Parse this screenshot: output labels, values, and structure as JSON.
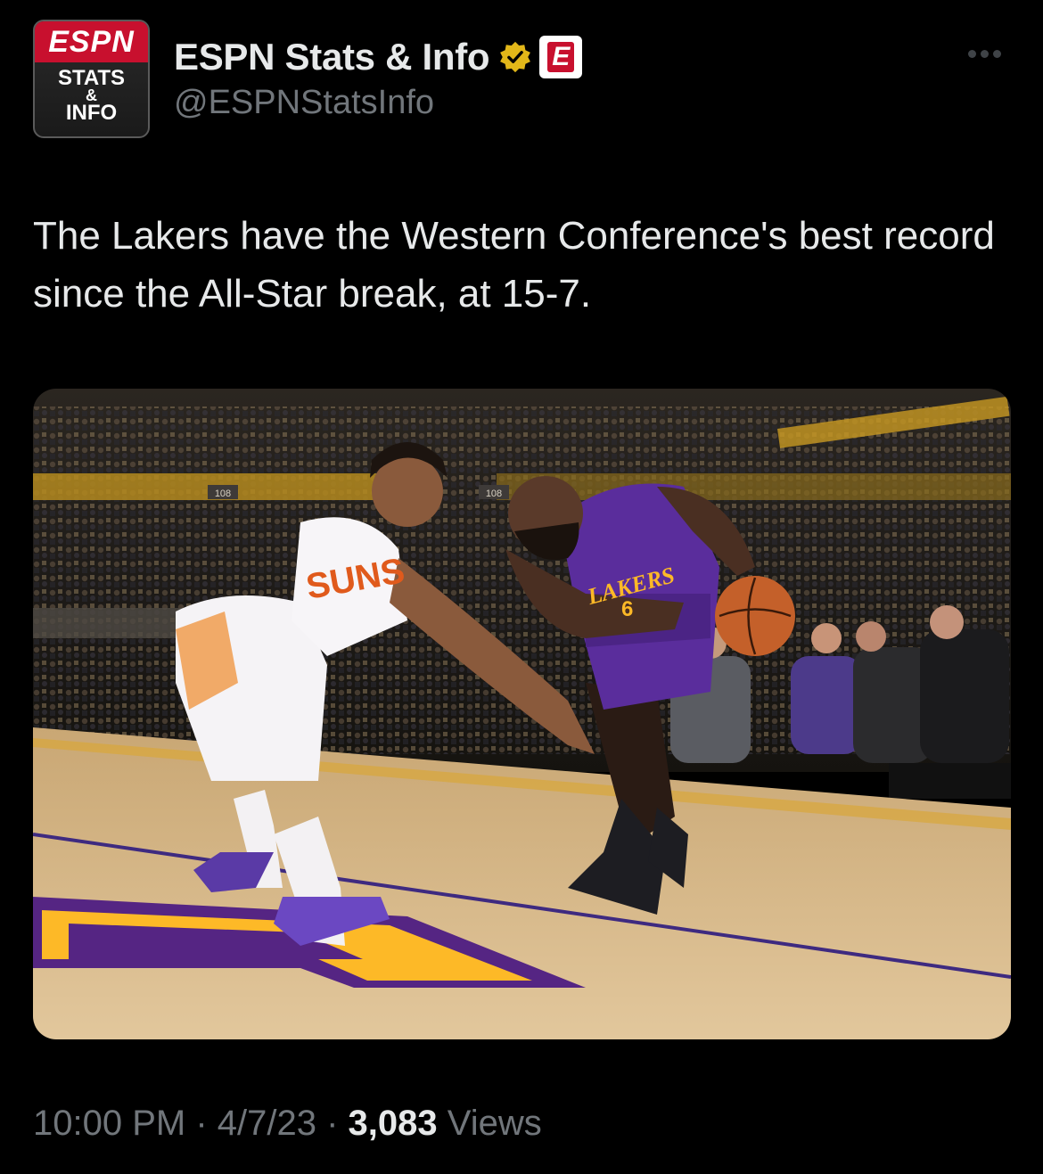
{
  "account": {
    "display_name": "ESPN Stats & Info",
    "handle": "@ESPNStatsInfo",
    "avatar_logo": "ESPN",
    "avatar_line1": "STATS",
    "avatar_line2": "&",
    "avatar_line3": "INFO",
    "affiliate_badge": "E",
    "verified_icon": "gold-check-badge"
  },
  "tweet": {
    "text": "The Lakers have the Western Conference's best record since the All-Star break, at 15-7."
  },
  "photo": {
    "jersey_left_text": "SUNS",
    "jersey_right_text": "LAKERS",
    "jersey_right_number": "6",
    "arena_sign_1": "108",
    "arena_sign_2": "108"
  },
  "meta": {
    "time": "10:00 PM",
    "sep1": " · ",
    "date": "4/7/23",
    "sep2": " · ",
    "views_count": "3,083",
    "views_label": " Views"
  },
  "colors": {
    "background": "#000000",
    "text_primary": "#e7e9ea",
    "text_secondary": "#71767b",
    "espn_red": "#c8102e",
    "lakers_purple": "#552583",
    "lakers_gold": "#fdb927"
  }
}
